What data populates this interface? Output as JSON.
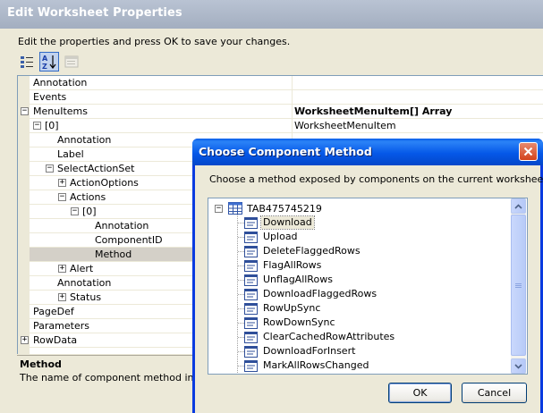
{
  "window": {
    "title": "Edit Worksheet Properties",
    "instructions": "Edit the properties and press OK to save your changes."
  },
  "toolbar": {
    "buttons": [
      {
        "icon": "categorized-icon",
        "pressed": false
      },
      {
        "icon": "alphabetical-sort-icon",
        "label": "AZ",
        "pressed": true
      },
      {
        "icon": "property-pages-icon",
        "pressed": false,
        "disabled": true
      }
    ]
  },
  "grid": {
    "rows": [
      {
        "name": "Annotation",
        "value": ""
      },
      {
        "name": "Events",
        "value": ""
      },
      {
        "name": "MenuItems",
        "value": "WorksheetMenuItem[] Array",
        "expander": "−"
      },
      {
        "name": "[0]",
        "value": "WorksheetMenuItem",
        "expander": "−"
      },
      {
        "name": "Annotation",
        "value": ""
      },
      {
        "name": "Label",
        "value": ""
      },
      {
        "name": "SelectActionSet",
        "value": "",
        "expander": "−"
      },
      {
        "name": "ActionOptions",
        "value": "",
        "expander": "+"
      },
      {
        "name": "Actions",
        "value": "",
        "expander": "−"
      },
      {
        "name": "[0]",
        "value": "",
        "expander": "−"
      },
      {
        "name": "Annotation",
        "value": ""
      },
      {
        "name": "ComponentID",
        "value": ""
      },
      {
        "name": "Method",
        "value": "",
        "selected": true
      },
      {
        "name": "Alert",
        "value": "",
        "expander": "+"
      },
      {
        "name": "Annotation",
        "value": ""
      },
      {
        "name": "Status",
        "value": "",
        "expander": "+"
      },
      {
        "name": "PageDef",
        "value": ""
      },
      {
        "name": "Parameters",
        "value": ""
      },
      {
        "name": "RowData",
        "value": "",
        "expander": "+"
      }
    ]
  },
  "description": {
    "title": "Method",
    "text": "The name of component method invoked"
  },
  "dialog": {
    "title": "Choose Component Method",
    "message": "Choose a method exposed by components on the current worksheet.",
    "tree": {
      "root": "TAB475745219",
      "items": [
        "Download",
        "Upload",
        "DeleteFlaggedRows",
        "FlagAllRows",
        "UnflagAllRows",
        "DownloadFlaggedRows",
        "RowUpSync",
        "RowDownSync",
        "ClearCachedRowAttributes",
        "DownloadForInsert",
        "MarkAllRowsChanged"
      ],
      "selected": "Download"
    },
    "ok_label": "OK",
    "cancel_label": "Cancel"
  }
}
